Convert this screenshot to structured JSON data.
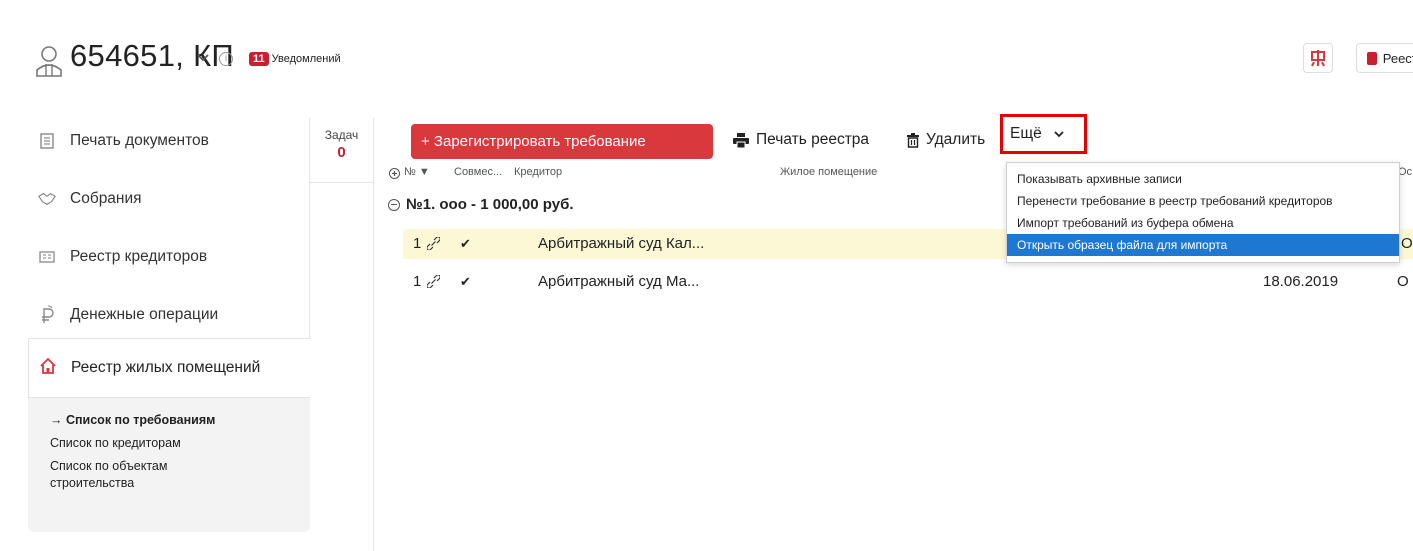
{
  "header": {
    "title": "654651, КП",
    "info": "i",
    "notifications_count": "11",
    "notifications_label": "Уведомлений",
    "register_button_label": "Реестр"
  },
  "sidebar": {
    "items": [
      {
        "label": "Печать документов",
        "icon": "document-icon"
      },
      {
        "label": "Собрания",
        "icon": "handshake-icon"
      },
      {
        "label": "Реестр кредиторов",
        "icon": "id-card-icon"
      },
      {
        "label": "Денежные операции",
        "icon": "ruble-icon"
      }
    ],
    "active_item": {
      "label": "Реестр жилых помещений",
      "icon": "home-icon"
    },
    "sub_items": [
      {
        "label": "→ Список по требованиям",
        "active": true
      },
      {
        "label": "Список по кредиторам",
        "active": false
      },
      {
        "label": "Список по объектам строительства",
        "active": false
      }
    ]
  },
  "tasks": {
    "label": "Задач",
    "count": "0"
  },
  "toolbar": {
    "register_label": "+ Зарегистрировать требование",
    "print_label": "Печать реестра",
    "delete_label": "Удалить",
    "more_label": "Ещё"
  },
  "table": {
    "columns": {
      "num": "№ ▼",
      "joint": "Совмес...",
      "creditor": "Кредитор",
      "premises": "Жилое помещение",
      "last": "Ос"
    },
    "group": "№1. ооо - 1 000,00 руб.",
    "rows": [
      {
        "num": "1",
        "check": "✔",
        "creditor": "Арбитражный  суд Кал...",
        "date": "",
        "last": "О",
        "highlight": true
      },
      {
        "num": "1",
        "check": "✔",
        "creditor": "Арбитражный  суд Ма...",
        "date": "18.06.2019",
        "last": "О",
        "highlight": false
      }
    ]
  },
  "dropdown": {
    "items": [
      {
        "label": "Показывать архивные записи",
        "selected": false
      },
      {
        "label": "Перенести требование в реестр требований кредиторов",
        "selected": false
      },
      {
        "label": "Импорт требований из буфера обмена",
        "selected": false
      },
      {
        "label": "Открыть образец файла для импорта",
        "selected": true
      }
    ]
  },
  "colors": {
    "accent_red": "#d9393d",
    "notif_red": "#c8202f",
    "highlight_box": "#e60000",
    "selection_blue": "#1e78d2",
    "row_highlight": "#fcf8d6"
  }
}
